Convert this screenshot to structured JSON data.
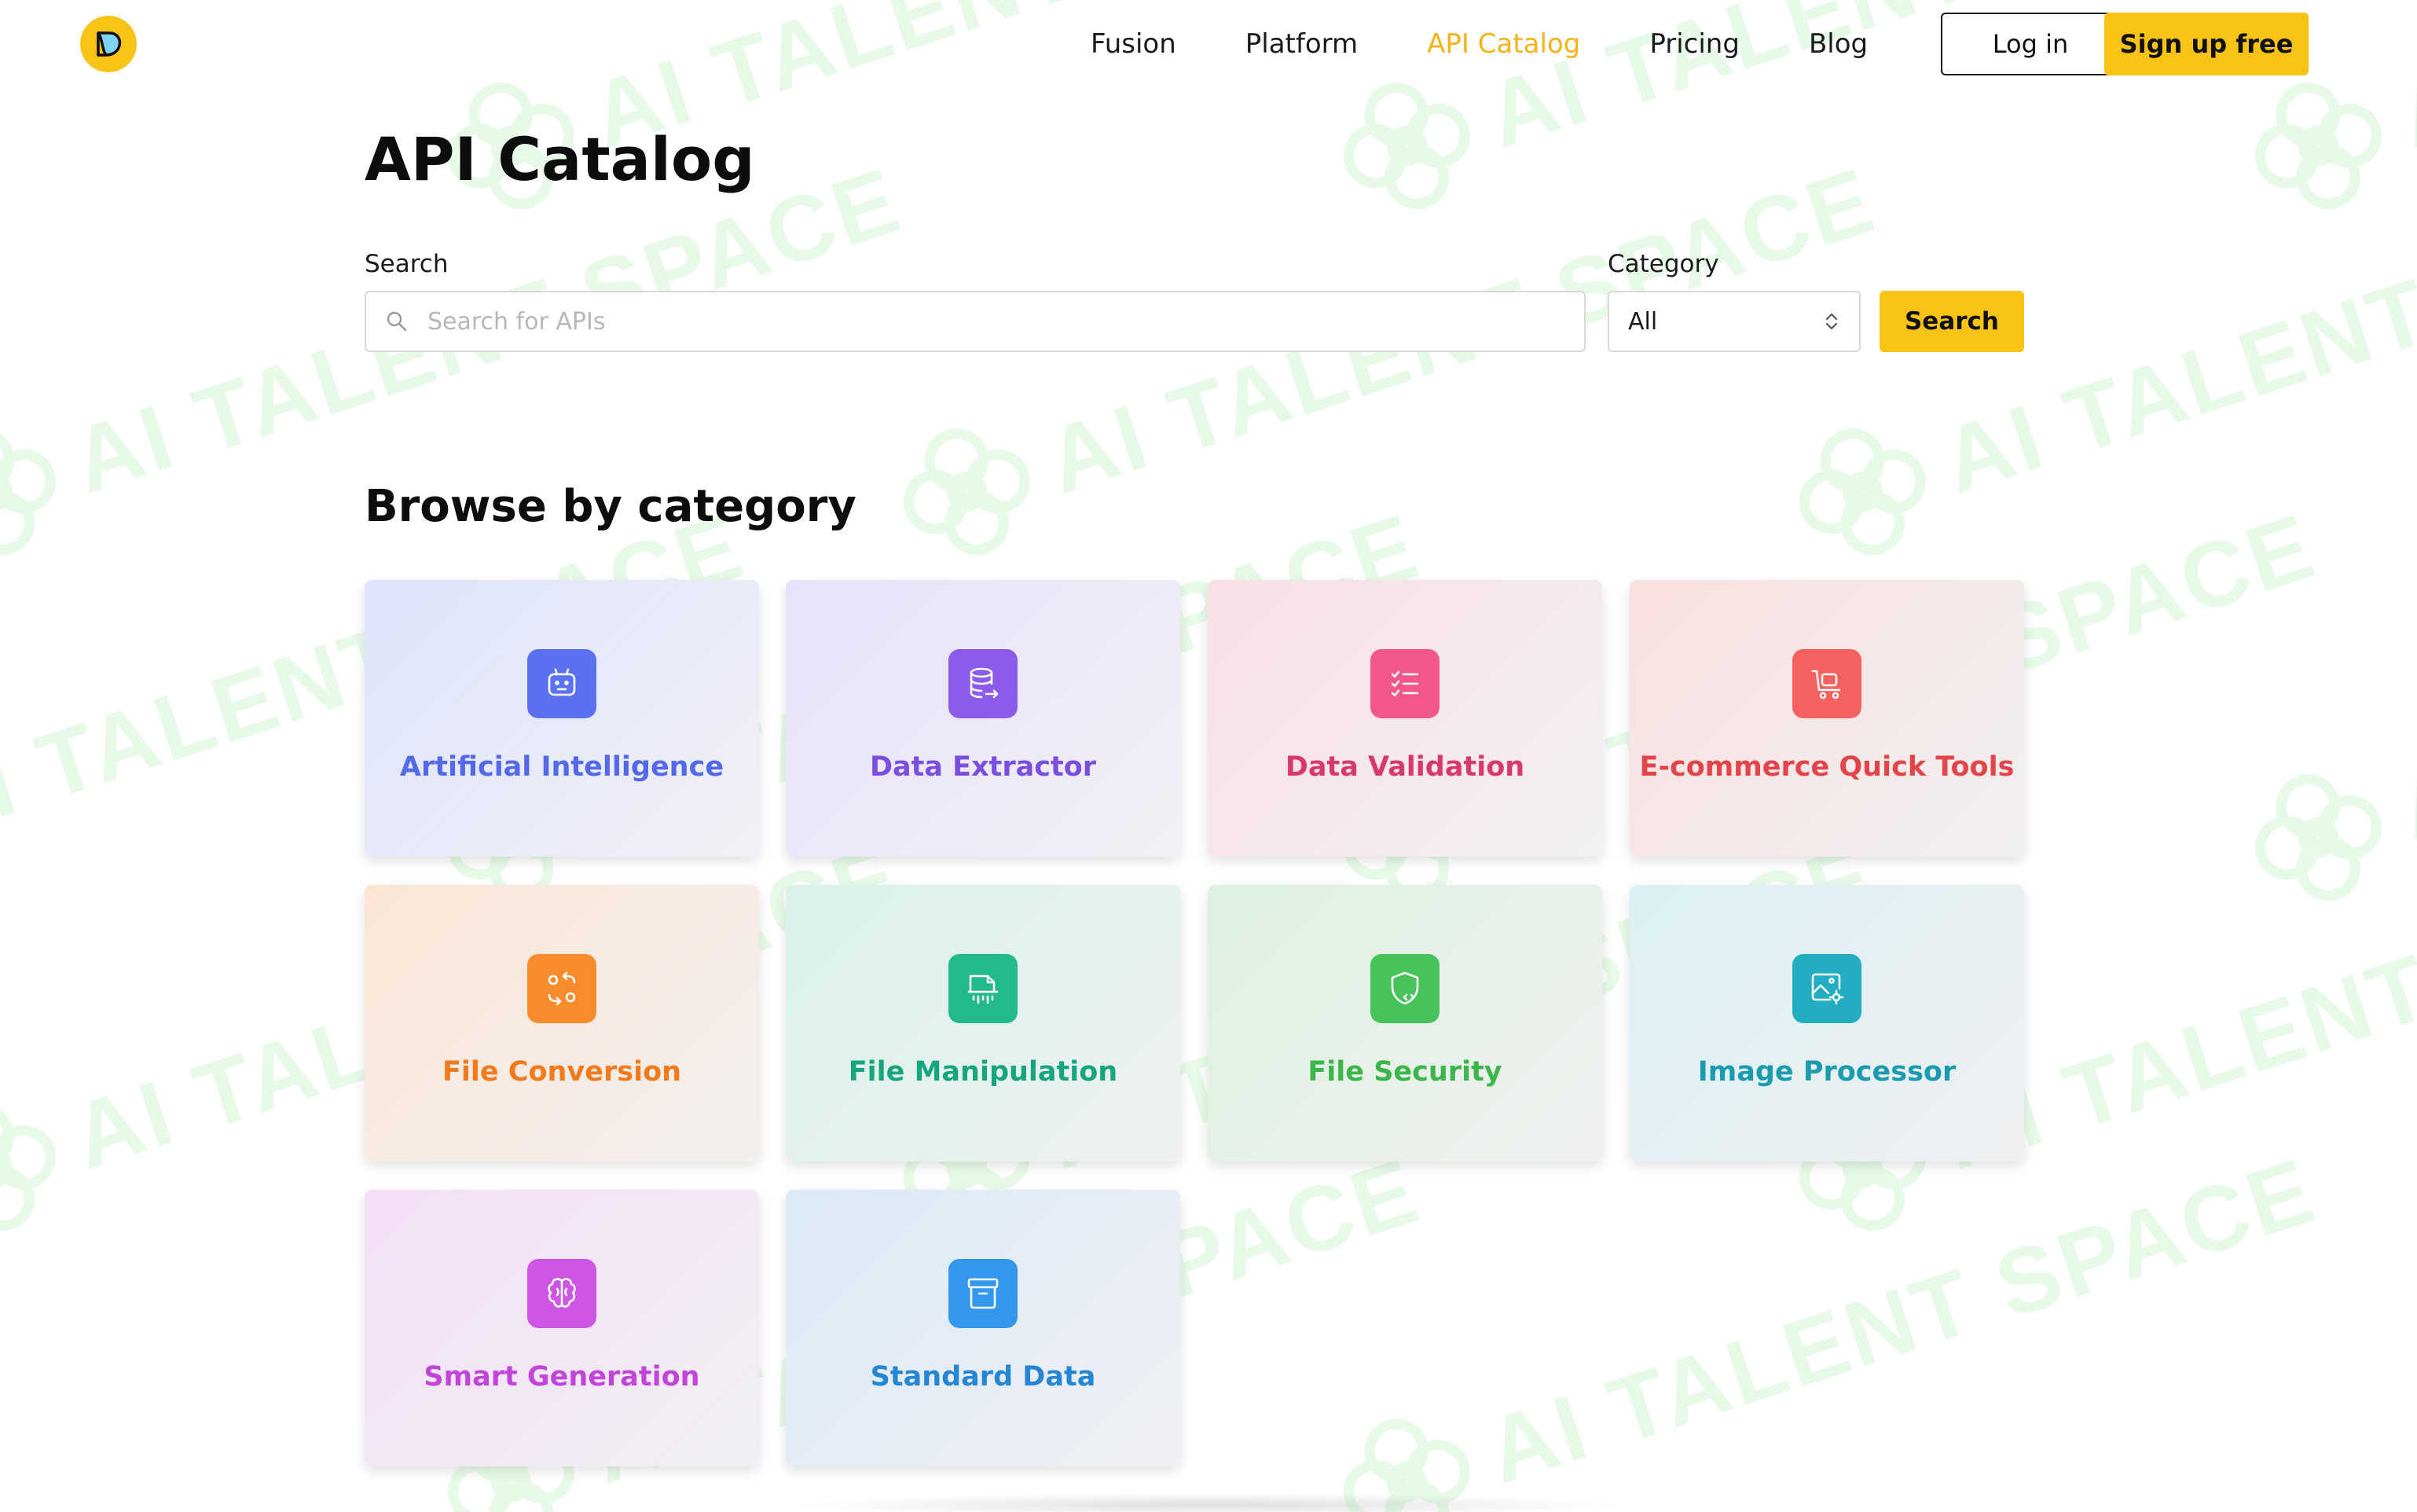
{
  "watermark": {
    "text": "AI TALENT SPACE",
    "color": "#d5f6d7"
  },
  "header": {
    "logo_icon": "brand-logo-icon",
    "nav": [
      {
        "label": "Fusion",
        "active": false
      },
      {
        "label": "Platform",
        "active": false
      },
      {
        "label": "API Catalog",
        "active": true
      },
      {
        "label": "Pricing",
        "active": false
      },
      {
        "label": "Blog",
        "active": false
      }
    ],
    "login_label": "Log in",
    "signup_label": "Sign up free",
    "accent_color": "#f8c316"
  },
  "page": {
    "title": "API Catalog",
    "search": {
      "label": "Search",
      "placeholder": "Search for APIs",
      "value": "",
      "icon": "search-icon"
    },
    "category": {
      "label": "Category",
      "selected": "All",
      "icon": "select-arrows-icon"
    },
    "search_button_label": "Search",
    "browse_title": "Browse by category",
    "categories": [
      {
        "name": "Artificial Intelligence",
        "icon": "robot-icon",
        "color": "#5469e8",
        "icon_bg": "#5b72f0",
        "bg_from": "#dde4fb",
        "bg_to": "#f1f0f6"
      },
      {
        "name": "Data Extractor",
        "icon": "database-export-icon",
        "color": "#7a4fe0",
        "icon_bg": "#8c5bea",
        "bg_from": "#e7e1fa",
        "bg_to": "#f2f0f6"
      },
      {
        "name": "Data Validation",
        "icon": "checklist-icon",
        "color": "#d8386e",
        "icon_bg": "#f2568a",
        "bg_from": "#f8dfe6",
        "bg_to": "#f2f0f2"
      },
      {
        "name": "E-commerce Quick Tools",
        "icon": "shopping-cart-icon",
        "color": "#e2444a",
        "icon_bg": "#f4615e",
        "bg_from": "#f9e0df",
        "bg_to": "#f1eff0"
      },
      {
        "name": "File Conversion",
        "icon": "convert-arrows-icon",
        "color": "#f07a1c",
        "icon_bg": "#f88b2c",
        "bg_from": "#fbe6d6",
        "bg_to": "#f2efee"
      },
      {
        "name": "File Manipulation",
        "icon": "file-edit-icon",
        "color": "#17a57f",
        "icon_bg": "#22b98d",
        "bg_from": "#d9f2e8",
        "bg_to": "#eef1f0"
      },
      {
        "name": "File Security",
        "icon": "shield-code-icon",
        "color": "#3bb54c",
        "icon_bg": "#47c35c",
        "bg_from": "#ddf1e0",
        "bg_to": "#eff1ef"
      },
      {
        "name": "Image Processor",
        "icon": "image-settings-icon",
        "color": "#1a9bb0",
        "icon_bg": "#22adc3",
        "bg_from": "#dbf0f4",
        "bg_to": "#eff0f2"
      },
      {
        "name": "Smart Generation",
        "icon": "brain-icon",
        "color": "#c045d8",
        "icon_bg": "#cd57e4",
        "bg_from": "#f3dff6",
        "bg_to": "#f1eff3"
      },
      {
        "name": "Standard Data",
        "icon": "archive-box-icon",
        "color": "#2586d4",
        "icon_bg": "#3397ec",
        "bg_from": "#dbe9f7",
        "bg_to": "#eff0f3"
      }
    ]
  }
}
